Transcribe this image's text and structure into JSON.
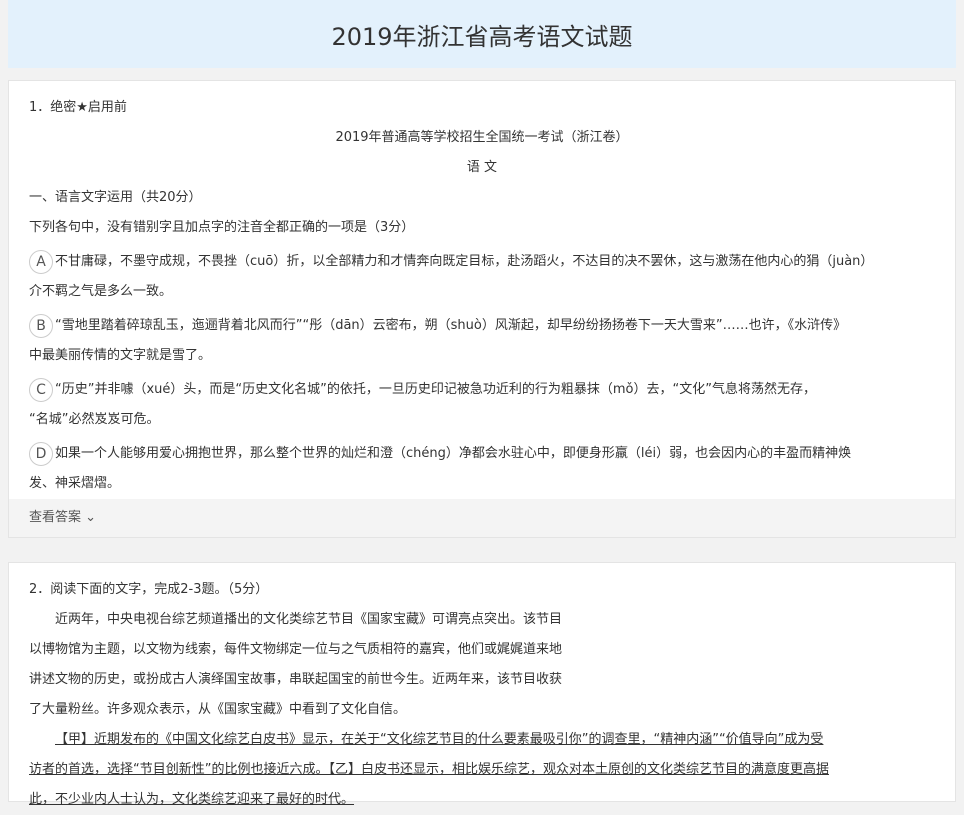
{
  "title": "2019年浙江省高考语文试题",
  "q1": {
    "head": "1．绝密★启用前",
    "exam": "2019年普通高等学校招生全国统一考试（浙江卷）",
    "subject": "语 文",
    "section": "一、语言文字运用（共20分）",
    "stem": "下列各句中，没有错别字且加点字的注音全都正确的一项是（3分）",
    "options": [
      {
        "letter": "A",
        "l1": "不甘庸碌，不墨守成规，不畏挫（cuō）折，以全部精力和才情奔向既定目标，赴汤蹈火，不达目的决不罢休，这与激荡在他内心的狷（juàn）",
        "l2": "介不羁之气是多么一致。"
      },
      {
        "letter": "B",
        "l1": "“雪地里踏着碎琼乱玉，迤逦背着北风而行”“彤（dān）云密布，朔（shuò）风渐起，却早纷纷扬扬卷下一天大雪来”……也许，《水浒传》",
        "l2": "中最美丽传情的文字就是雪了。"
      },
      {
        "letter": "C",
        "l1": "“历史”并非噱（xué）头，而是“历史文化名城”的依托，一旦历史印记被急功近利的行为粗暴抹（mǒ）去，“文化”气息将荡然无存，",
        "l2": "“名城”必然岌岌可危。"
      },
      {
        "letter": "D",
        "l1": "如果一个人能够用爱心拥抱世界，那么整个世界的灿烂和澄（chéng）净都会水驻心中，即便身形羸（léi）弱，也会因内心的丰盈而精神焕",
        "l2": "发、神采熠熠。"
      }
    ],
    "view_answer": "查看答案"
  },
  "q2": {
    "head": "2．阅读下面的文字，完成2-3题。（5分）",
    "p1": [
      "近两年，中央电视台综艺频道播出的文化类综艺节目《国家宝藏》可谓亮点突出。该节目",
      "以博物馆为主题，以文物为线索，每件文物绑定一位与之气质相符的嘉宾，他们或娓娓道来地",
      "讲述文物的历史，或扮成古人演绎国宝故事，串联起国宝的前世今生。近两年来，该节目收获",
      "了大量粉丝。许多观众表示，从《国家宝藏》中看到了文化自信。"
    ],
    "p2": [
      "【甲】近期发布的《中国文化综艺白皮书》显示，在关于“文化综艺节目的什么要素最吸引你”的调查里，“精神内涵”“价值导向”成为受",
      "访者的首选，选择“节目创新性”的比例也接近六成。【乙】白皮书还显示，相比娱乐综艺，观众对本土原创的文化类综艺节目的满意度更高据",
      "此，不少业内人士认为，文化类综艺迎来了最好的时代。"
    ]
  }
}
